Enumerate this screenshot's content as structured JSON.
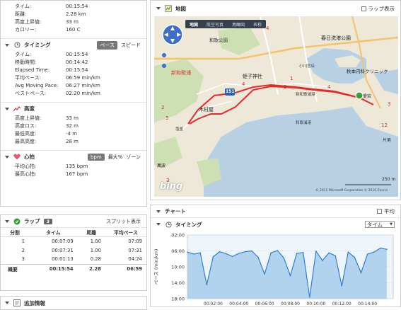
{
  "summary": {
    "rows": [
      {
        "label": "タイム:",
        "value": "00:15:54"
      },
      {
        "label": "距離:",
        "value": "2.28 km"
      },
      {
        "label": "高度上昇値:",
        "value": "33 m"
      },
      {
        "label": "カロリー:",
        "value": "160 C"
      }
    ]
  },
  "timing": {
    "title": "タイミング",
    "tabs": {
      "pace": "ペース",
      "speed": "スピード"
    },
    "rows": [
      {
        "label": "タイム:",
        "value": "00:15:54"
      },
      {
        "label": "移動時間:",
        "value": "00:14:42"
      },
      {
        "label": "Elapsed Time:",
        "value": "00:15:54"
      },
      {
        "label": "平均ペース:",
        "value": "06:59 min/km"
      },
      {
        "label": "Avg Moving Pace:",
        "value": "06:27 min/km"
      },
      {
        "label": "ベストペース:",
        "value": "02:20 min/km"
      }
    ]
  },
  "elevation": {
    "title": "高度",
    "rows": [
      {
        "label": "高度上昇値:",
        "value": "33 m"
      },
      {
        "label": "高度ロス:",
        "value": "32 m"
      },
      {
        "label": "最低高度:",
        "value": "-4 m"
      },
      {
        "label": "最高高度:",
        "value": "28 m"
      }
    ]
  },
  "heart": {
    "title": "心拍",
    "tabs": {
      "bpm": "bpm",
      "max": "最大%",
      "zone": "ゾーン"
    },
    "rows": [
      {
        "label": "平均心拍:",
        "value": "135 bpm"
      },
      {
        "label": "最高心拍:",
        "value": "167 bpm"
      }
    ]
  },
  "laps": {
    "title": "ラップ",
    "count": "3",
    "split_link": "スプリット表示",
    "columns": [
      "分割",
      "タイム",
      "距離",
      "平均ペース"
    ],
    "rows": [
      [
        "1",
        "00:07:09",
        "1.00",
        "07:09"
      ],
      [
        "2",
        "00:07:31",
        "1.00",
        "07:31"
      ],
      [
        "3",
        "00:01:13",
        "0.28",
        "04:24"
      ]
    ],
    "summary": [
      "概要",
      "00:15:54",
      "2.28",
      "06:59"
    ]
  },
  "extra": {
    "title": "追加情報"
  },
  "map": {
    "title": "地図",
    "lap_checkbox": "ラップ表示",
    "map_tabs": [
      "地図",
      "航空写真",
      "鳥瞰図",
      "名称"
    ],
    "scale": "250 m",
    "brand": "bing",
    "copyright": "© 2011 Microsoft Corporation  © 2010 Zenrin",
    "labels": [
      "和歌公園",
      "新和歌浦",
      "蛭子神社",
      "木村屋",
      "雑賀崎",
      "塩釜",
      "新和歌浦",
      "小川宮店",
      "雑賀崎港",
      "萬波",
      "秋本内科クリニック",
      "和歌川",
      "片男",
      "春日洗港公園",
      "愛宕",
      "玉津島",
      "新和歌浦港",
      "和歌浦港"
    ],
    "numbers": [
      "4",
      "4",
      "2",
      "3",
      "1",
      "2",
      "3",
      "4",
      "2",
      "4",
      "3",
      "1",
      "1",
      "12",
      "3"
    ],
    "route_badge": "151"
  },
  "chart": {
    "title": "チャート",
    "avg_checkbox": "平均",
    "section": "タイミング",
    "select": "タイム"
  },
  "chart_data": {
    "type": "area",
    "ylabel": "ペース (min/km)",
    "y_ticks": [
      "02:00",
      "06:00",
      "10:00",
      "14:00",
      "18:00"
    ],
    "x_ticks": [
      "00:02:00",
      "00:04:00",
      "00:06:00",
      "00:08:00",
      "00:10:00",
      "00:12:00",
      "00:14:00"
    ],
    "ylim": [
      "02:00",
      "18:00"
    ],
    "x": [
      "00:00:00",
      "00:00:30",
      "00:01:00",
      "00:01:30",
      "00:02:00",
      "00:02:30",
      "00:03:00",
      "00:03:30",
      "00:04:00",
      "00:04:30",
      "00:05:00",
      "00:05:30",
      "00:06:00",
      "00:06:30",
      "00:07:00",
      "00:07:30",
      "00:08:00",
      "00:08:30",
      "00:09:00",
      "00:09:30",
      "00:10:00",
      "00:10:30",
      "00:11:00",
      "00:11:30",
      "00:12:00",
      "00:12:30",
      "00:13:00",
      "00:13:30",
      "00:14:00",
      "00:14:30",
      "00:15:00",
      "00:15:30"
    ],
    "values": [
      6.3,
      6.8,
      6.5,
      14.5,
      7.5,
      6.2,
      6.7,
      7.4,
      6.6,
      6.2,
      6.0,
      7.6,
      11.8,
      6.5,
      5.9,
      7.8,
      12.2,
      6.6,
      6.4,
      17.6,
      6.1,
      8.4,
      6.5,
      7.2,
      14.8,
      6.3,
      7.6,
      11.5,
      6.8,
      6.3,
      5.3,
      5.6
    ]
  }
}
